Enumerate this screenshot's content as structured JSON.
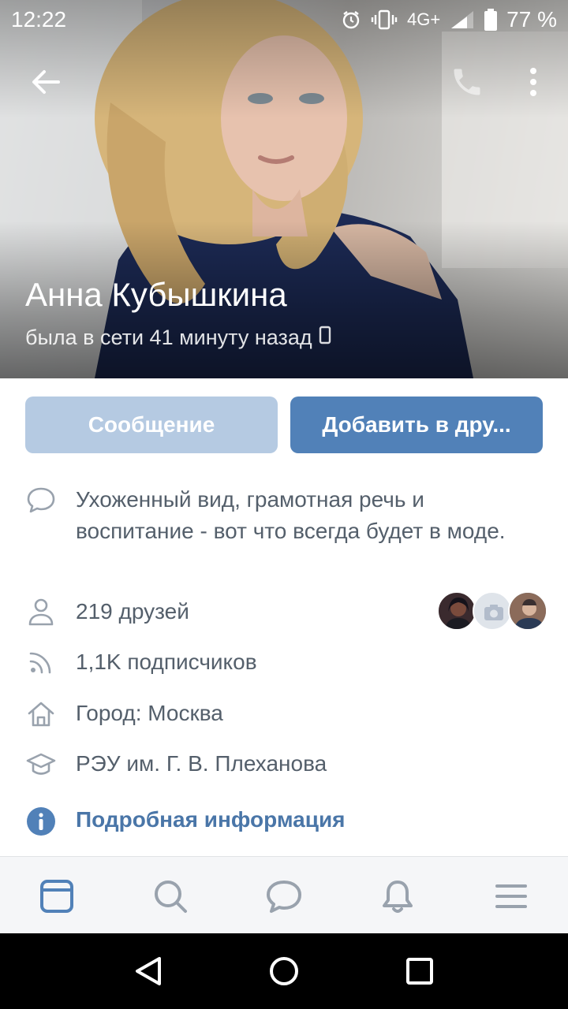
{
  "status_bar": {
    "time": "12:22",
    "network": "4G+",
    "battery": "77 %",
    "icons": [
      "alarm-icon",
      "vibrate-icon",
      "signal-icon",
      "battery-icon"
    ]
  },
  "header": {
    "icons": [
      "back-arrow-icon",
      "phone-icon",
      "more-vertical-icon"
    ]
  },
  "profile": {
    "name": "Анна Кубышкина",
    "last_seen": "была в сети 41 минуту назад"
  },
  "actions": {
    "message_label": "Сообщение",
    "add_friend_label": "Добавить в дру..."
  },
  "info": {
    "about": "Ухоженный вид, грамотная речь и воспитание - вот что всегда будет в моде.",
    "friends": "219 друзей",
    "followers": "1,1K подписчиков",
    "city": "Город: Москва",
    "education": "РЭУ им. Г. В. Плеханова",
    "details_link": "Подробная информация"
  },
  "tabbar": {
    "items": [
      "news-icon",
      "search-icon",
      "messages-icon",
      "notifications-icon",
      "menu-icon"
    ],
    "active": "news-icon"
  },
  "colors": {
    "accent": "#5181b8",
    "accent_light": "#b5cae2",
    "link": "#4a76a8",
    "text_secondary": "#545f6b",
    "icon": "#99a2ad",
    "tabbar_bg": "#f5f6f8"
  }
}
